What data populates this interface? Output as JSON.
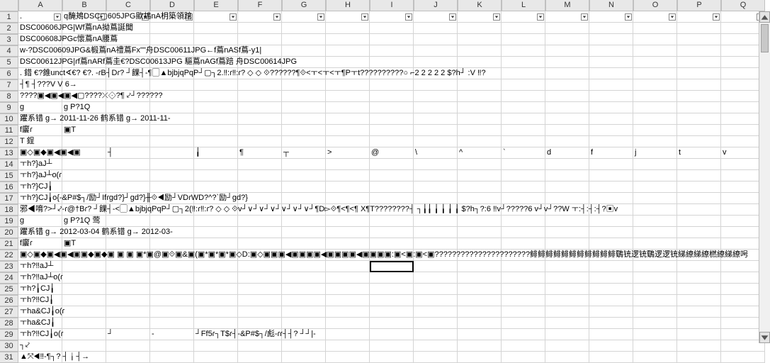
{
  "columns": [
    "A",
    "B",
    "C",
    "D",
    "E",
    "F",
    "G",
    "H",
    "I",
    "J",
    "K",
    "L",
    "M",
    "N",
    "O",
    "P",
    "Q"
  ],
  "row_count": 31,
  "selected_cell": {
    "row": 23,
    "col": "I"
  },
  "filter_row": 1,
  "rows": {
    "1": {
      "A": "."
    },
    "1_overlay": "q馣鴂DSC▢605JPG歞鴣nA枂築領踣",
    "2": {
      "A": "DSC00606JPG|Wf蔦nA拗蔦誕聞"
    },
    "3": {
      "A": "DSC00608JPGc懷蔦nA腰蔦"
    },
    "4": {
      "A": "w-?DSC00609JPG&椴蔦nA禮蔦Fx\"\"舟DSC00611JPG←f蔦nASf蔦-y1|"
    },
    "5": {
      "A": "DSC00612JPG|ɾf蔦nARf蔦圭€?DSC00613JPG 驅蔦nAGf蔦踣  舟DSC00614JPG"
    },
    "6": {
      "A": ".   錯      €?錐unct∢€?   €?.       -ɾB┤Dɾ?  ┘餜┤-¶▢▲bjbjqPqP┘▢┐2.‼:ɾ‼:ɾ?    ◇    ◇   ⟐??????¶⟐<ㅜ<ㅜ<ㅜ¶Pㅜt??????????○ ⌐2 2 2 2 2 $?h┘ :V ‼?"
    },
    "7": {
      "A": "┤¶ ┤???V V 6→"
    },
    "8": {
      "A": "????▣◀▣◀▣◀▢????⤫⟐?¶ ⤦┘??????"
    },
    "9": {
      "A": "g",
      "B": "g P?1Q"
    },
    "10": {
      "A": "躣系错 g→    2011-11-26    鹤系错 g→    2011-11-"
    },
    "11": {
      "A": "f廲ɾ",
      "B": "▣T"
    },
    "12": {
      "A": "T 鋥"
    },
    "13": {
      "A": "▣◇▣◆▣◀▣◀▣",
      "C": "┤",
      "E": "╽",
      "F": "¶",
      "G": "┬",
      "H": ">",
      "I": "@",
      "J": "\\",
      "K": "^",
      "L": "`",
      "M": "d",
      "N": "f",
      "O": "j",
      "P": "t",
      "Q": "v"
    },
    "14": {
      "A": "ㅜh?}aJ┴"
    },
    "15": {
      "A": "ㅜh?}aJ┴o(ɾ"
    },
    "16": {
      "A": "ㅜh?}CJ╽"
    },
    "17": {
      "A": "ㅜh?}CJ╽o{-&P#$┐/励┘Ifɾgd?}┘gd?}╫⟐◀励┘VDɾWD?^?`励┘gd?}"
    },
    "18": {
      "A": "邪◀唷?>┘⤦-ɾ@†Bɾ? ┘餜┤-<▢▲bjbjqPqP┘▢┐2(‼:ɾ‼:ɾ?    ◇    ◇   ⟐v┘∨┘∨┘∨┘∨┘∨┘∨┘¶D▻⟐¶<¶<¶ X¶T????????┤ ┐╽╽ ╽ ╽ ╽ ╽ $?h┐?:6 ‼v┘?????6 v┘v┘??W ㅜ:┤:┤:┤?▣v"
    },
    "19": {
      "A": "g",
      "B": "g P?1Q 莺"
    },
    "20": {
      "A": "躣系错 g→    2012-03-04    鹤系错 g→    2012-03-"
    },
    "21": {
      "A": "f廲ɾ",
      "B": "▣T"
    },
    "22": {
      "A": "▣◇▣◆▣◀▣◀▣▣◆▣◆▣ ▣ ▣ ▣*▣@▣⟐▣&▣(▣*▣*▣*▣◇D:▣◇▣▣▣◀▣▣▣▣◀▣▣▣▣◀▣▣▣▣:▣<▣:▣<▣??????????????????????鲱鲱鲱鲱鲱鲱鲱鲱鲱鲱鲱鸀铳逻铳鸀逻逻铳綈繚綈繚橪繚綈繚呺"
    },
    "23": {
      "A": "ㅜh?‼aJ┴"
    },
    "24": {
      "A": "ㅜh?‼aJ┴o(ɾ"
    },
    "25": {
      "A": "ㅜh?╽CJ╽"
    },
    "26": {
      "A": "ㅜh?‼CJ╽"
    },
    "27": {
      "A": "ㅜha&CJ╽o(ɾ"
    },
    "28": {
      "A": "ㅜha&CJ╽"
    },
    "29": {
      "A": "ㅜh?‼CJ╽o(ɾ",
      "C": "┘",
      "D": "-",
      "E": "┘Ff5ɾ┐T$ɾ┤-&P#$┐/彪-ɾɾ┤┤? ┘┘|-"
    },
    "30": {
      "A": "┐⤦"
    },
    "31": {
      "A": "▲⤧◀‼-¶┐?   ┤╽┤→"
    }
  }
}
